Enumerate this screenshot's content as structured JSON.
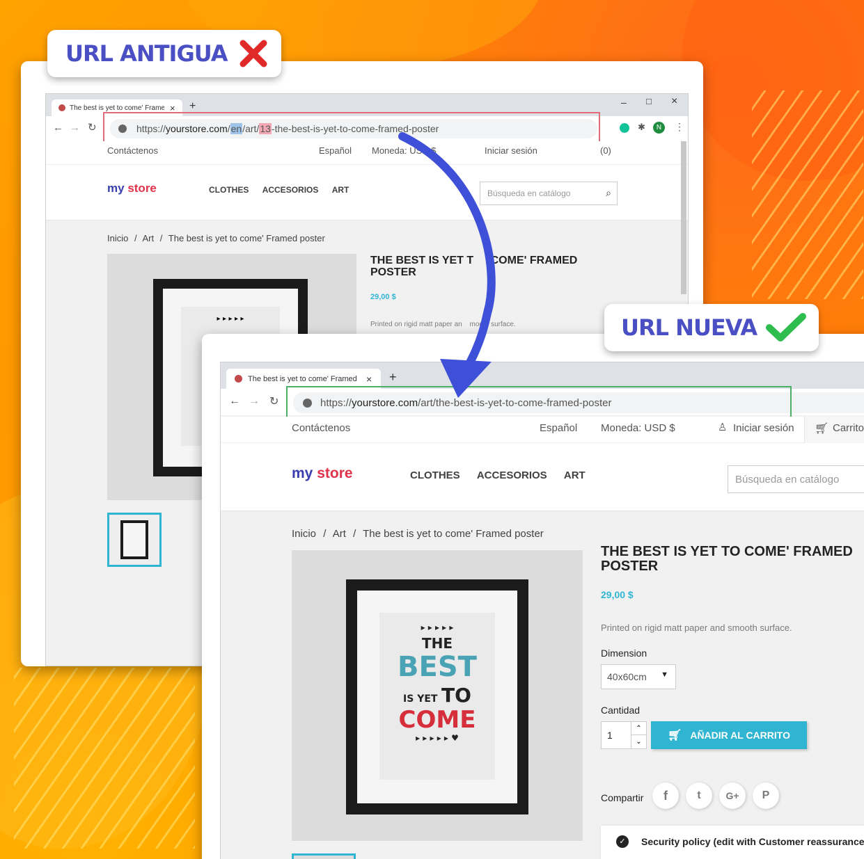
{
  "old_label": {
    "text": "URL ANTIGUA",
    "icon": "x-icon",
    "icon_color": "#e02a2a",
    "text_color": "#4a4fc4"
  },
  "new_label": {
    "text": "URL NUEVA",
    "icon": "check-icon",
    "icon_color": "#2ebd4e",
    "text_color": "#4a4fc4"
  },
  "old_browser": {
    "tab_title": "The best is yet to come' Framed",
    "tab_close": "×",
    "new_tab": "+",
    "win_min": "–",
    "win_max": "□",
    "win_close": "×",
    "url_prefix": "https://",
    "url_host": "yourstore.com",
    "url_sep": "/",
    "url_lang": "en",
    "url_cat": "/art/",
    "url_id": "13",
    "url_rest": "-the-best-is-yet-to-come-framed-poster",
    "highlight_color": "#e06b7a"
  },
  "new_browser": {
    "tab_title": "The best is yet to come' Framed",
    "tab_close": "×",
    "new_tab": "+",
    "url_prefix": "https://",
    "url_host": "yourstore.com",
    "url_rest": "/art/the-best-is-yet-to-come-framed-poster",
    "highlight_color": "#4caf66"
  },
  "store": {
    "contact": "Contáctenos",
    "language": "Español",
    "currency": "Moneda: USD $",
    "signin": "Iniciar sesión",
    "cart": "Carrito",
    "cart_count": "(0)",
    "logo_my": "my",
    "logo_store": "store",
    "nav": [
      "CLOTHES",
      "ACCESORIOS",
      "ART"
    ],
    "search_placeholder": "Búsqueda en catálogo",
    "breadcrumb": [
      "Inicio",
      "Art",
      "The best is yet to come' Framed poster"
    ],
    "crumb_sep": "/",
    "product_title_line1": "THE BEST IS YET TO COME' FRAMED",
    "product_title_line2": "POSTER",
    "old_title_a": "THE BEST IS YET T",
    "old_title_b": "COME' FRAMED",
    "price": "29,00 $",
    "description": "Printed on rigid matt paper and smooth surface.",
    "old_description_a": "Printed on rigid matt paper an",
    "old_description_b": "mooth surface.",
    "dimension_label": "Dimension",
    "dimension_value": "40x60cm",
    "quantity_label": "Cantidad",
    "quantity_value": "1",
    "add_to_cart": "AÑADIR AL CARRITO",
    "share_label": "Compartir",
    "share_icons": [
      "f",
      "t",
      "G+",
      "P"
    ],
    "reassurance": "Security policy (edit with Customer reassurance"
  },
  "poster": {
    "line1": "▸ ▸ ▸ ▸ ▸",
    "the": "THE",
    "best": "BEST",
    "isyet": "IS YET",
    "to": "TO",
    "come": "COME",
    "line2": "▸ ▸ ▸ ▸ ▸ ♥"
  }
}
